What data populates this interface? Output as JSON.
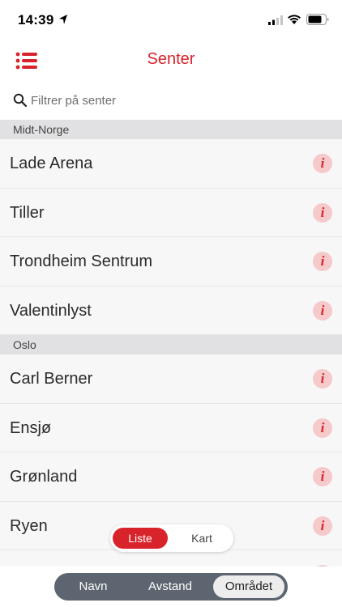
{
  "status_bar": {
    "time": "14:39"
  },
  "nav": {
    "title": "Senter"
  },
  "search": {
    "placeholder": "Filtrer på senter",
    "value": ""
  },
  "sections": [
    {
      "title": "Midt-Norge",
      "items": [
        "Lade Arena",
        "Tiller",
        "Trondheim Sentrum",
        "Valentinlyst"
      ]
    },
    {
      "title": "Oslo",
      "items": [
        "Carl Berner",
        "Ensjø",
        "Grønland",
        "Ryen"
      ]
    }
  ],
  "info_glyph": "i",
  "view_toggle": {
    "list_label": "Liste",
    "map_label": "Kart",
    "selected": "Liste"
  },
  "sort_control": {
    "options": [
      "Navn",
      "Avstand",
      "Området"
    ],
    "selected": "Området"
  },
  "colors": {
    "accent": "#d8232a",
    "info_bg": "#f6c9cb",
    "section_bg": "#e1e1e3",
    "segment_bg": "#5d6670"
  },
  "icons": {
    "menu": "list-menu-icon",
    "search": "search-icon",
    "info": "info-icon",
    "location": "location-arrow-icon"
  }
}
